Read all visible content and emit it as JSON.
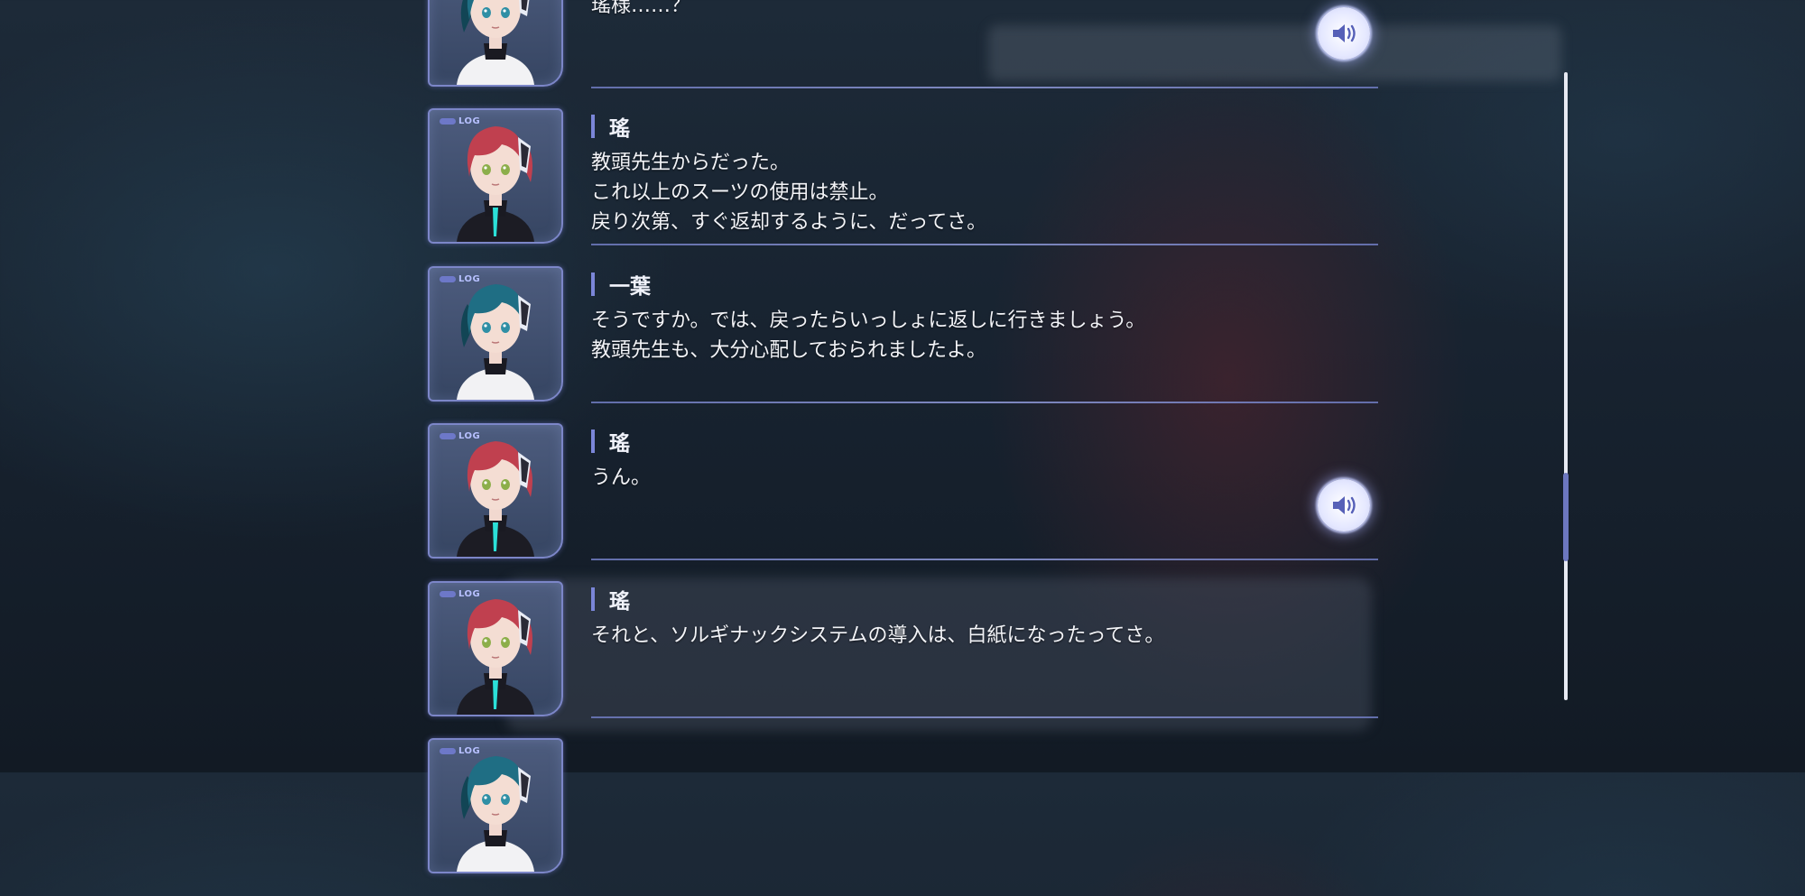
{
  "entries": [
    {
      "speaker": "",
      "character": "kazuha",
      "show_log_tag": false,
      "text": "瑤様……？",
      "has_voice": true
    },
    {
      "speaker": "瑤",
      "character": "yo",
      "show_log_tag": true,
      "text": "教頭先生からだった。\nこれ以上のスーツの使用は禁止。\n戻り次第、すぐ返却するように、だってさ。",
      "has_voice": false
    },
    {
      "speaker": "一葉",
      "character": "kazuha",
      "show_log_tag": true,
      "text": "そうですか。では、戻ったらいっしょに返しに行きましょう。\n教頭先生も、大分心配しておられましたよ。",
      "has_voice": false
    },
    {
      "speaker": "瑤",
      "character": "yo",
      "show_log_tag": true,
      "text": "うん。",
      "has_voice": true
    },
    {
      "speaker": "瑤",
      "character": "yo",
      "show_log_tag": true,
      "text": "それと、ソルギナックシステムの導入は、白紙になったってさ。",
      "has_voice": false
    },
    {
      "speaker": "",
      "character": "kazuha",
      "show_log_tag": true,
      "text": "",
      "has_voice": false
    }
  ],
  "log_tag": "LOG",
  "icons": {
    "voice": "speaker-icon"
  },
  "colors": {
    "accent": "#7b86d8",
    "divider": "#6a76b8",
    "text": "#f3f4f8",
    "kazuha_hair": "#1f6e84",
    "yo_hair": "#c0404f"
  },
  "scrollbar": {
    "position_fraction": 0.68
  }
}
